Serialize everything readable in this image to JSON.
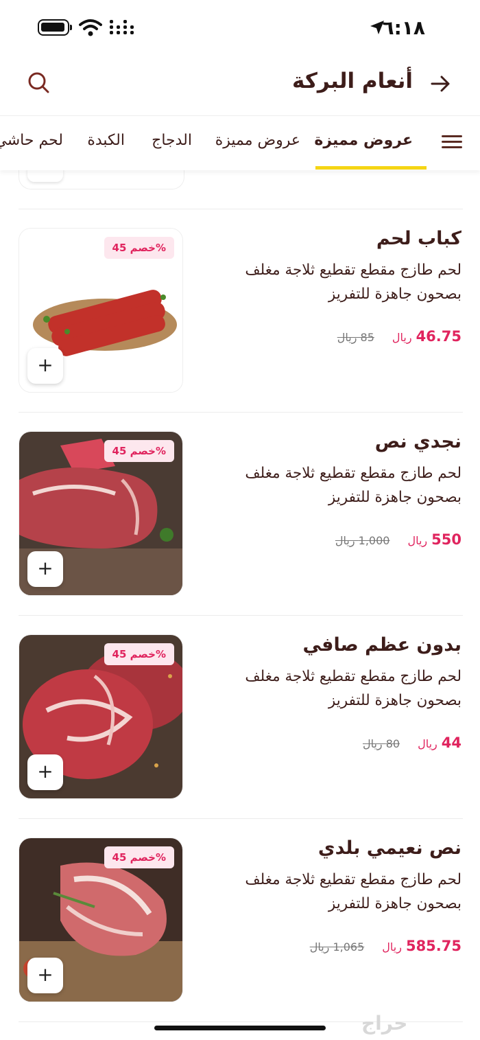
{
  "status": {
    "time": "٦:١٨"
  },
  "header": {
    "title": "أنعام البركة"
  },
  "tabs": [
    {
      "label": "عروض مميزة"
    },
    {
      "label": "عروض مميزة"
    },
    {
      "label": "الدجاج"
    },
    {
      "label": "الكبدة"
    },
    {
      "label": "لحم حاشي"
    }
  ],
  "products": [
    {
      "name": "كباب لحم",
      "desc": "لحم طازج مقطع تقطيع ثلاجة مغلف بصحون جاهزة للتفريز",
      "price": "46.75",
      "currency": "ريال",
      "old_price": "85 ريال",
      "badge": "خصم 45%",
      "add": "+"
    },
    {
      "name": "نجدي نص",
      "desc": "لحم طازج مقطع تقطيع ثلاجة مغلف بصحون جاهزة للتفريز",
      "price": "550",
      "currency": "ريال",
      "old_price": "1,000 ريال",
      "badge": "خصم 45%",
      "add": "+"
    },
    {
      "name": "بدون عظم صافي",
      "desc": "لحم طازج مقطع تقطيع ثلاجة مغلف بصحون جاهزة للتفريز",
      "price": "44",
      "currency": "ريال",
      "old_price": "80 ريال",
      "badge": "خصم 45%",
      "add": "+"
    },
    {
      "name": "نص نعيمي بلدي",
      "desc": "لحم طازج مقطع تقطيع ثلاجة مغلف بصحون جاهزة للتفريز",
      "price": "585.75",
      "currency": "ريال",
      "old_price": "1,065 ريال",
      "badge": "خصم 45%",
      "add": "+"
    }
  ],
  "watermark": "حراج",
  "colors": {
    "accent": "#e0245e",
    "tab_underline": "#f5d515",
    "title": "#3d1d1a"
  }
}
